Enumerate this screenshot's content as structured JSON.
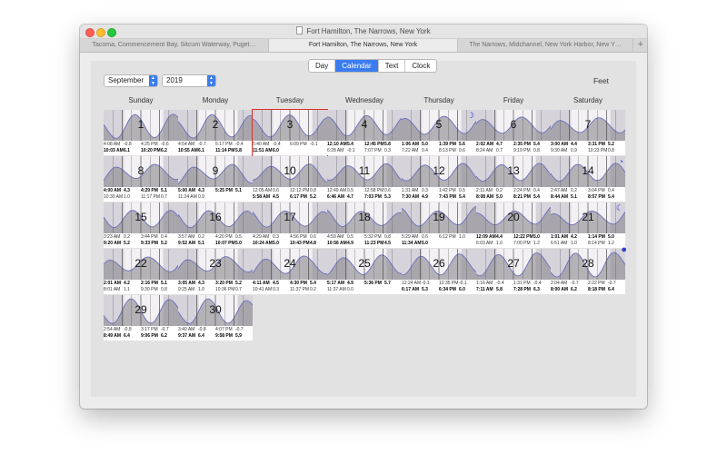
{
  "window": {
    "title": "Fort Hamilton, The Narrows, New York"
  },
  "tabs": [
    {
      "label": "Tacoma, Commencement Bay, Sitcum Waterway, Puget…",
      "active": false
    },
    {
      "label": "Fort Hamilton, The Narrows, New York",
      "active": true
    },
    {
      "label": "The Narrows, Midchannel, New York Harbor, New Y…",
      "active": false
    }
  ],
  "add_tab_label": "+",
  "view_modes": [
    {
      "label": "Day",
      "active": false
    },
    {
      "label": "Calendar",
      "active": true
    },
    {
      "label": "Text",
      "active": false
    },
    {
      "label": "Clock",
      "active": false
    }
  ],
  "month_select": {
    "value": "September"
  },
  "year_select": {
    "value": "2019"
  },
  "units_label": "Feet",
  "weekdays": [
    "Sunday",
    "Monday",
    "Tuesday",
    "Wednesday",
    "Thursday",
    "Friday",
    "Saturday"
  ],
  "colors": {
    "accent": "#3b7cf0",
    "selection": "#d9302a",
    "moon": "#2d3fd0",
    "curve": "#6b6fc0"
  },
  "selected_day": 3,
  "days": [
    {
      "day": "1",
      "rows": [
        [
          "4:08 AM",
          "-0.8",
          "4:25 PM",
          "-0.6",
          0
        ],
        [
          "10:03 AM",
          "6.1",
          "10:20 PM",
          "6.2",
          1
        ]
      ]
    },
    {
      "day": "2",
      "rows": [
        [
          "4:54 AM",
          "-0.7",
          "5:17 PM",
          "-0.4",
          0
        ],
        [
          "10:55 AM",
          "6.1",
          "11:14 PM",
          "5.8",
          1
        ]
      ]
    },
    {
      "day": "3",
      "rows": [
        [
          "5:40 AM",
          "-0.4",
          "6:09 PM",
          "-0.1",
          0
        ],
        [
          "11:51 AM",
          "6.0",
          "",
          "",
          1
        ]
      ]
    },
    {
      "day": "4",
      "rows": [
        [
          "12:10 AM",
          "5.4",
          "12:45 PM",
          "5.8",
          1
        ],
        [
          "6:28 AM",
          "-0.1",
          "7:07 PM",
          "0.3",
          0
        ]
      ]
    },
    {
      "day": "5",
      "moon": "☽",
      "rows": [
        [
          "1:06 AM",
          "5.0",
          "1:39 PM",
          "5.6",
          1
        ],
        [
          "7:22 AM",
          "0.4",
          "8:13 PM",
          "0.6",
          0
        ]
      ]
    },
    {
      "day": "6",
      "rows": [
        [
          "2:02 AM",
          "4.7",
          "2:35 PM",
          "5.4",
          1
        ],
        [
          "8:24 AM",
          "0.7",
          "9:19 PM",
          "0.8",
          0
        ]
      ]
    },
    {
      "day": "7",
      "rows": [
        [
          "3:00 AM",
          "4.4",
          "3:31 PM",
          "5.2",
          1
        ],
        [
          "9:30 AM",
          "0.9",
          "10:23 PM",
          "0.8",
          0
        ]
      ]
    },
    {
      "day": "8",
      "rows": [
        [
          "4:00 AM",
          "4.3",
          "4:29 PM",
          "5.1",
          1
        ],
        [
          "10:30 AM",
          "1.0",
          "11:17 PM",
          "0.7",
          0
        ]
      ]
    },
    {
      "day": "9",
      "rows": [
        [
          "5:00 AM",
          "4.3",
          "5:25 PM",
          "5.1",
          1
        ],
        [
          "11:24 AM",
          "0.9",
          "",
          "",
          0
        ]
      ]
    },
    {
      "day": "10",
      "rows": [
        [
          "12:05 AM",
          "0.6",
          "12:12 PM",
          "0.8",
          0
        ],
        [
          "5:58 AM",
          "4.5",
          "6:17 PM",
          "5.2",
          1
        ]
      ]
    },
    {
      "day": "11",
      "rows": [
        [
          "12:49 AM",
          "0.5",
          "12:58 PM",
          "0.6",
          0
        ],
        [
          "6:46 AM",
          "4.7",
          "7:03 PM",
          "5.3",
          1
        ]
      ]
    },
    {
      "day": "12",
      "rows": [
        [
          "1:31 AM",
          "0.3",
          "1:42 PM",
          "0.5",
          0
        ],
        [
          "7:30 AM",
          "4.9",
          "7:43 PM",
          "5.4",
          1
        ]
      ]
    },
    {
      "day": "13",
      "rows": [
        [
          "2:11 AM",
          "0.2",
          "2:24 PM",
          "0.4",
          0
        ],
        [
          "8:08 AM",
          "5.0",
          "8:21 PM",
          "5.4",
          1
        ]
      ]
    },
    {
      "day": "14",
      "moon": "◔",
      "rows": [
        [
          "2:47 AM",
          "0.2",
          "3:04 PM",
          "0.4",
          0
        ],
        [
          "8:44 AM",
          "5.1",
          "8:57 PM",
          "5.4",
          1
        ]
      ]
    },
    {
      "day": "15",
      "rows": [
        [
          "3:23 AM",
          "0.2",
          "3:44 PM",
          "0.4",
          0
        ],
        [
          "9:20 AM",
          "5.2",
          "9:33 PM",
          "5.2",
          1
        ]
      ]
    },
    {
      "day": "16",
      "rows": [
        [
          "3:57 AM",
          "0.2",
          "4:20 PM",
          "0.5",
          0
        ],
        [
          "9:52 AM",
          "5.1",
          "10:07 PM",
          "5.0",
          1
        ]
      ]
    },
    {
      "day": "17",
      "rows": [
        [
          "4:29 AM",
          "0.3",
          "4:56 PM",
          "0.6",
          0
        ],
        [
          "10:24 AM",
          "5.0",
          "10:43 PM",
          "4.8",
          1
        ]
      ]
    },
    {
      "day": "18",
      "rows": [
        [
          "4:59 AM",
          "0.5",
          "5:32 PM",
          "0.8",
          0
        ],
        [
          "10:56 AM",
          "4.9",
          "11:23 PM",
          "4.5",
          1
        ]
      ]
    },
    {
      "day": "19",
      "rows": [
        [
          "5:29 AM",
          "0.6",
          "6:12 PM",
          "1.0",
          0
        ],
        [
          "11:34 AM",
          "5.0",
          "",
          "",
          1
        ]
      ]
    },
    {
      "day": "20",
      "rows": [
        [
          "12:09 AM",
          "4.4",
          "12:22 PM",
          "5.0",
          1
        ],
        [
          "6:03 AM",
          "1.0",
          "7:00 PM",
          "1.2",
          0
        ]
      ]
    },
    {
      "day": "21",
      "moon": "☾",
      "rows": [
        [
          "1:01 AM",
          "4.2",
          "1:14 PM",
          "5.0",
          1
        ],
        [
          "6:51 AM",
          "1.0",
          "8:14 PM",
          "1.2",
          0
        ]
      ]
    },
    {
      "day": "22",
      "rows": [
        [
          "2:01 AM",
          "4.2",
          "2:16 PM",
          "5.1",
          1
        ],
        [
          "8:01 AM",
          "1.1",
          "9:30 PM",
          "0.8",
          0
        ]
      ]
    },
    {
      "day": "23",
      "rows": [
        [
          "3:05 AM",
          "4.3",
          "3:20 PM",
          "5.2",
          1
        ],
        [
          "9:25 AM",
          "1.0",
          "10:36 PM",
          "0.7",
          0
        ]
      ]
    },
    {
      "day": "24",
      "rows": [
        [
          "4:11 AM",
          "4.5",
          "4:30 PM",
          "5.4",
          1
        ],
        [
          "10:41 AM",
          "0.3",
          "11:37 PM",
          "0.2",
          0
        ]
      ]
    },
    {
      "day": "25",
      "rows": [
        [
          "5:17 AM",
          "4.9",
          "5:36 PM",
          "5.7",
          1
        ],
        [
          "11:37 AM",
          "0.0",
          "",
          "",
          0
        ]
      ]
    },
    {
      "day": "26",
      "rows": [
        [
          "12:24 AM",
          "-0.1",
          "12:35 PM",
          "-0.1",
          0
        ],
        [
          "6:17 AM",
          "5.3",
          "6:34 PM",
          "6.0",
          1
        ]
      ]
    },
    {
      "day": "27",
      "rows": [
        [
          "1:16 AM",
          "-0.4",
          "1:31 PM",
          "-0.4",
          0
        ],
        [
          "7:11 AM",
          "5.8",
          "7:28 PM",
          "6.3",
          1
        ]
      ]
    },
    {
      "day": "28",
      "moon": "●",
      "rows": [
        [
          "2:04 AM",
          "-0.7",
          "2:22 PM",
          "-0.7",
          0
        ],
        [
          "8:00 AM",
          "6.2",
          "8:18 PM",
          "6.4",
          1
        ]
      ]
    },
    {
      "day": "29",
      "rows": [
        [
          "2:54 AM",
          "-0.8",
          "3:17 PM",
          "-0.7",
          0
        ],
        [
          "8:49 AM",
          "6.4",
          "9:06 PM",
          "6.2",
          1
        ]
      ]
    },
    {
      "day": "30",
      "rows": [
        [
          "3:40 AM",
          "-0.8",
          "4:07 PM",
          "-0.7",
          0
        ],
        [
          "9:37 AM",
          "6.4",
          "9:58 PM",
          "5.9",
          1
        ]
      ]
    }
  ]
}
